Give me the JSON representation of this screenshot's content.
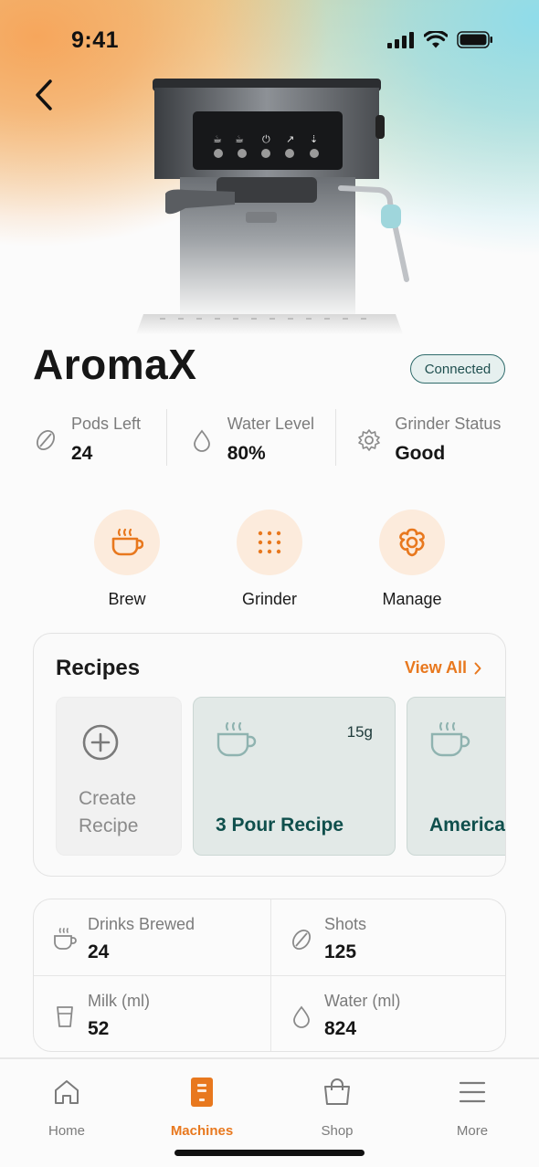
{
  "status_bar": {
    "time": "9:41"
  },
  "machine": {
    "name": "AromaX",
    "connection_status": "Connected"
  },
  "stats": [
    {
      "label": "Pods Left",
      "value": "24",
      "icon": "coffee-bean-icon"
    },
    {
      "label": "Water Level",
      "value": "80%",
      "icon": "water-drop-icon"
    },
    {
      "label": "Grinder Status",
      "value": "Good",
      "icon": "gear-icon"
    }
  ],
  "actions": [
    {
      "label": "Brew",
      "icon": "coffee-cup-icon"
    },
    {
      "label": "Grinder",
      "icon": "grid-dots-icon"
    },
    {
      "label": "Manage",
      "icon": "settings-flower-icon"
    }
  ],
  "recipes": {
    "title": "Recipes",
    "view_all": "View All",
    "create_label_line1": "Create",
    "create_label_line2": "Recipe",
    "items": [
      {
        "name": "3 Pour Recipe",
        "grams": "15g"
      },
      {
        "name": "Americano",
        "grams": ""
      }
    ]
  },
  "metrics": [
    {
      "label": "Drinks Brewed",
      "value": "24",
      "icon": "coffee-cup-icon"
    },
    {
      "label": "Shots",
      "value": "125",
      "icon": "coffee-bean-icon"
    },
    {
      "label": "Milk (ml)",
      "value": "52",
      "icon": "glass-icon"
    },
    {
      "label": "Water (ml)",
      "value": "824",
      "icon": "water-drop-icon"
    }
  ],
  "tabbar": {
    "active": "Machines",
    "tabs": [
      {
        "label": "Home",
        "icon": "home-icon"
      },
      {
        "label": "Machines",
        "icon": "machine-icon"
      },
      {
        "label": "Shop",
        "icon": "shopping-bag-icon"
      },
      {
        "label": "More",
        "icon": "menu-icon"
      }
    ]
  },
  "colors": {
    "accent": "#e8781e",
    "teal": "#0f4f4c",
    "accent_soft": "#fcebdc"
  }
}
